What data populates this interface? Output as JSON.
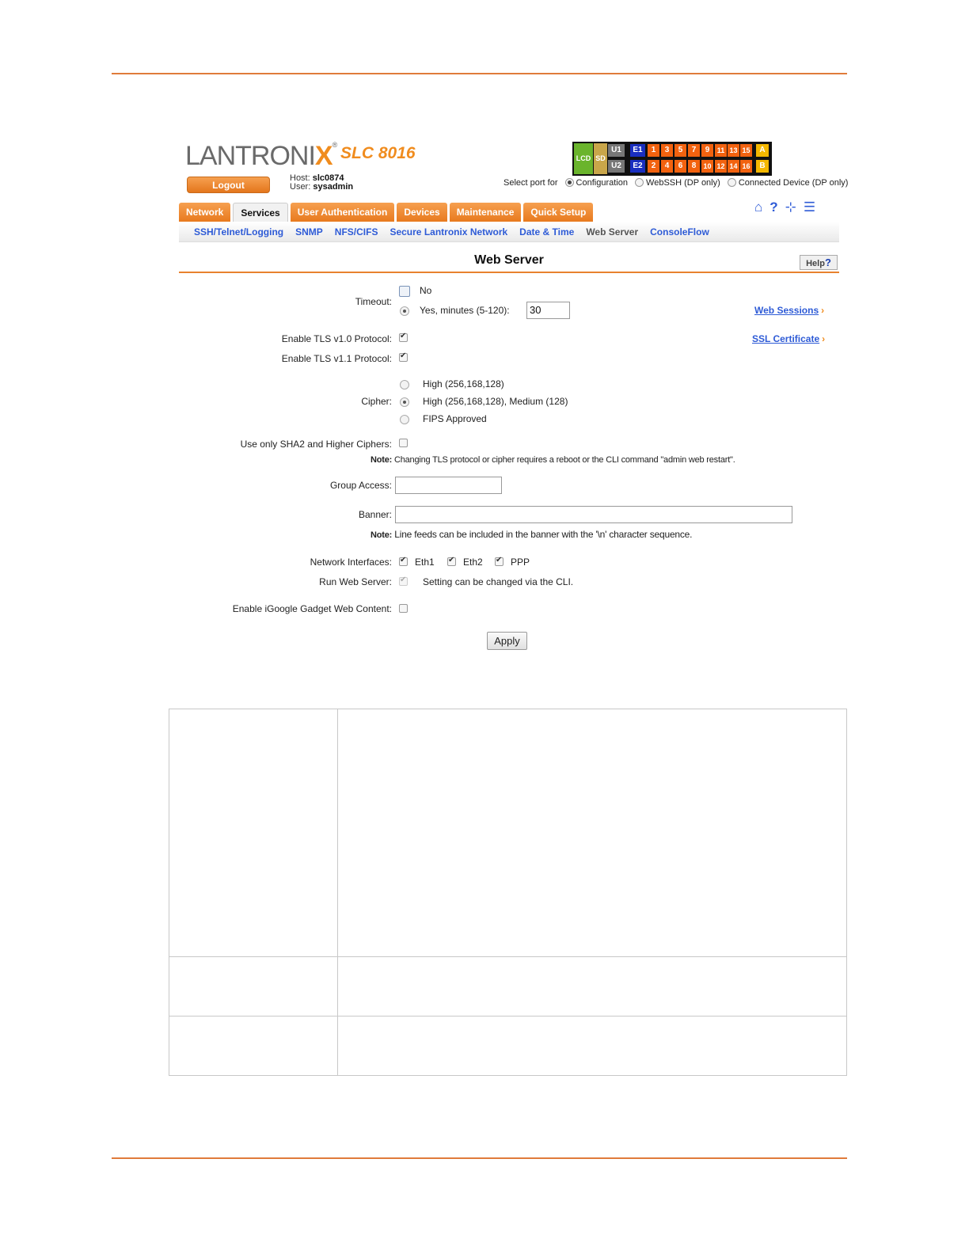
{
  "brand": {
    "logo_main": "LANTRONI",
    "logo_x": "X",
    "logo_reg": "®",
    "model": "SLC 8016"
  },
  "header": {
    "logout_label": "Logout",
    "host_label": "Host:",
    "host_value": "slc0874",
    "user_label": "User:",
    "user_value": "sysadmin",
    "select_port_label": "Select port for",
    "port_options": [
      "Configuration",
      "WebSSH (DP only)",
      "Connected Device (DP only)"
    ],
    "port_selected": "Configuration"
  },
  "port_panel": {
    "lcd": "LCD",
    "sd": "SD",
    "u1": "U1",
    "u2": "U2",
    "e1": "E1",
    "e2": "E2",
    "top_row": [
      "1",
      "3",
      "5",
      "7",
      "9",
      "11",
      "13",
      "15"
    ],
    "bottom_row": [
      "2",
      "4",
      "6",
      "8",
      "10",
      "12",
      "14",
      "16"
    ],
    "a": "A",
    "b": "B"
  },
  "tabs": [
    "Network",
    "Services",
    "User Authentication",
    "Devices",
    "Maintenance",
    "Quick Setup"
  ],
  "active_tab": "Services",
  "top_icons": [
    "home-icon",
    "help-icon",
    "site-map-icon",
    "log-icon"
  ],
  "subnav": [
    "SSH/Telnet/Logging",
    "SNMP",
    "NFS/CIFS",
    "Secure Lantronix Network",
    "Date & Time",
    "Web Server",
    "ConsoleFlow"
  ],
  "subnav_current": "Web Server",
  "page_title": "Web Server",
  "help_label": "Help",
  "help_q": "?",
  "form": {
    "timeout_label": "Timeout:",
    "timeout_no": "No",
    "timeout_yes": "Yes, minutes (5-120):",
    "timeout_value": "30",
    "web_sessions_link": "Web Sessions",
    "ssl_certificate_link": "SSL Certificate",
    "tls10_label": "Enable TLS v1.0 Protocol:",
    "tls11_label": "Enable TLS v1.1 Protocol:",
    "cipher_label": "Cipher:",
    "cipher_options": [
      "High (256,168,128)",
      "High (256,168,128), Medium (128)",
      "FIPS Approved"
    ],
    "cipher_selected": "High (256,168,128), Medium (128)",
    "sha2_label": "Use only SHA2 and Higher Ciphers:",
    "note1_label": "Note:",
    "note1_text": "Changing TLS protocol or cipher requires a reboot or the CLI command \"admin web restart\".",
    "group_access_label": "Group Access:",
    "group_access_value": "",
    "banner_label": "Banner:",
    "banner_value": "",
    "note2_label": "Note:",
    "note2_text": "Line feeds can be included in the banner with the '\\n' character sequence.",
    "network_interfaces_label": "Network Interfaces:",
    "interfaces": [
      "Eth1",
      "Eth2",
      "PPP"
    ],
    "run_web_server_label": "Run Web Server:",
    "run_web_server_note": "Setting can be changed via the CLI.",
    "igoogle_label": "Enable iGoogle Gadget Web Content:",
    "apply_label": "Apply"
  }
}
